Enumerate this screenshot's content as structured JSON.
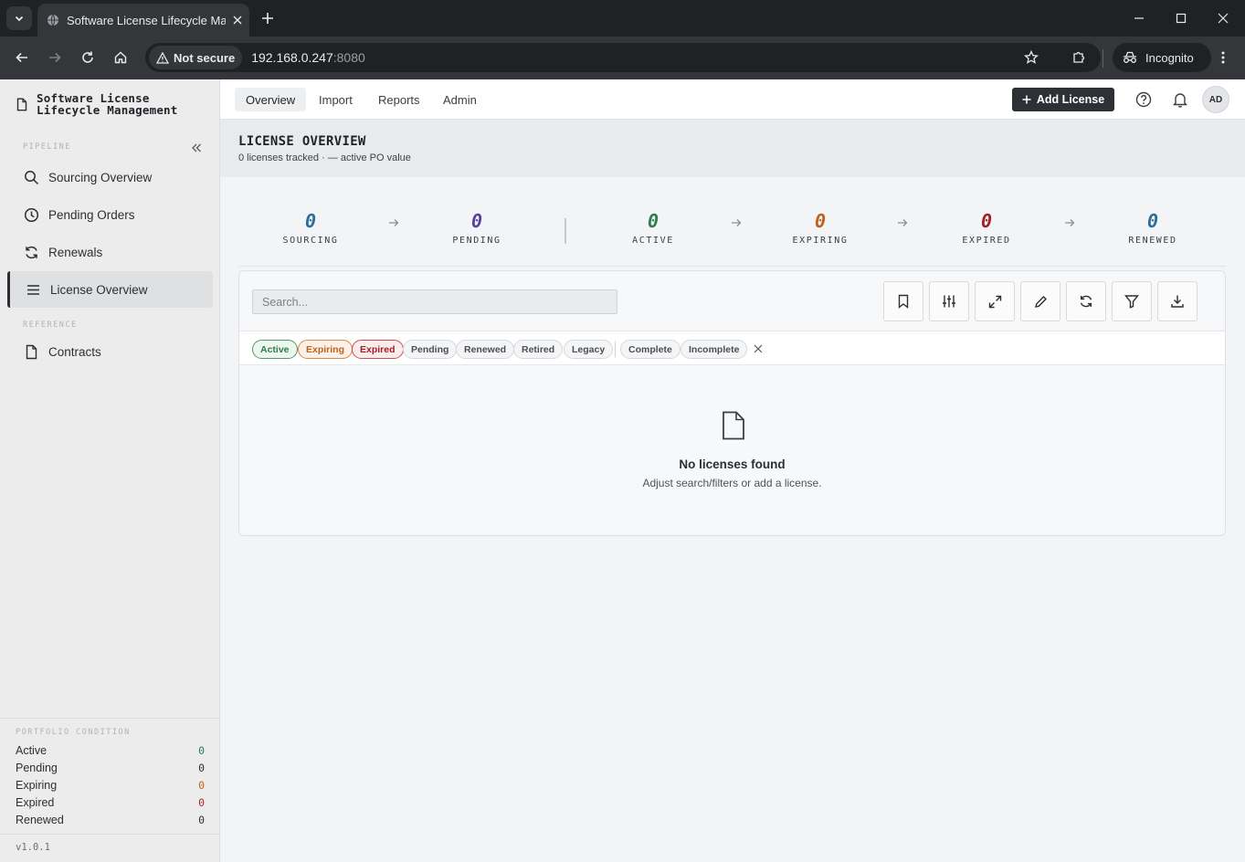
{
  "browser": {
    "tab_title": "Software License Lifecycle Mana",
    "security_label": "Not secure",
    "url_host": "192.168.0.247",
    "url_port": ":8080",
    "incognito_label": "Incognito"
  },
  "sidebar": {
    "brand_line1": "Software License",
    "brand_line2": "Lifecycle Management",
    "section_pipeline": "PIPELINE",
    "section_reference": "REFERENCE",
    "items": [
      {
        "label": "Sourcing Overview",
        "icon": "search-icon"
      },
      {
        "label": "Pending Orders",
        "icon": "clock-icon"
      },
      {
        "label": "Renewals",
        "icon": "refresh-icon"
      },
      {
        "label": "License Overview",
        "icon": "list-icon",
        "active": true
      },
      {
        "label": "Contracts",
        "icon": "document-icon"
      }
    ],
    "portfolio": {
      "title": "PORTFOLIO CONDITION",
      "rows": [
        {
          "label": "Active",
          "value": "0",
          "color": "#2e7d4f"
        },
        {
          "label": "Pending",
          "value": "0",
          "color": "#2b2f33"
        },
        {
          "label": "Expiring",
          "value": "0",
          "color": "#c0601a"
        },
        {
          "label": "Expired",
          "value": "0",
          "color": "#b3262d"
        },
        {
          "label": "Renewed",
          "value": "0",
          "color": "#2b2f33"
        }
      ]
    },
    "version": "v1.0.1"
  },
  "topnav": {
    "tabs": [
      {
        "label": "Overview",
        "active": true
      },
      {
        "label": "Import"
      },
      {
        "label": "Reports"
      },
      {
        "label": "Admin"
      }
    ],
    "add_button": "Add License",
    "avatar": "AD"
  },
  "header": {
    "title": "LICENSE OVERVIEW",
    "subtitle": "0 licenses tracked · — active PO value"
  },
  "pipeline": [
    {
      "label": "SOURCING",
      "value": "0",
      "color": "#2a6f9a"
    },
    {
      "label": "PENDING",
      "value": "0",
      "color": "#5b3f9e"
    },
    {
      "label": "ACTIVE",
      "value": "0",
      "color": "#2e7d4f"
    },
    {
      "label": "EXPIRING",
      "value": "0",
      "color": "#c0601a"
    },
    {
      "label": "EXPIRED",
      "value": "0",
      "color": "#a61e25"
    },
    {
      "label": "RENEWED",
      "value": "0",
      "color": "#2a6f9a"
    }
  ],
  "table": {
    "search_placeholder": "Search...",
    "tools": [
      "bookmark-icon",
      "sliders-icon",
      "expand-icon",
      "pencil-icon",
      "refresh-icon",
      "filter-icon",
      "download-icon"
    ],
    "chips": [
      "Active",
      "Expiring",
      "Expired",
      "Pending",
      "Renewed",
      "Retired",
      "Legacy",
      "Complete",
      "Incomplete"
    ],
    "empty_title": "No licenses found",
    "empty_subtitle": "Adjust search/filters or add a license."
  }
}
